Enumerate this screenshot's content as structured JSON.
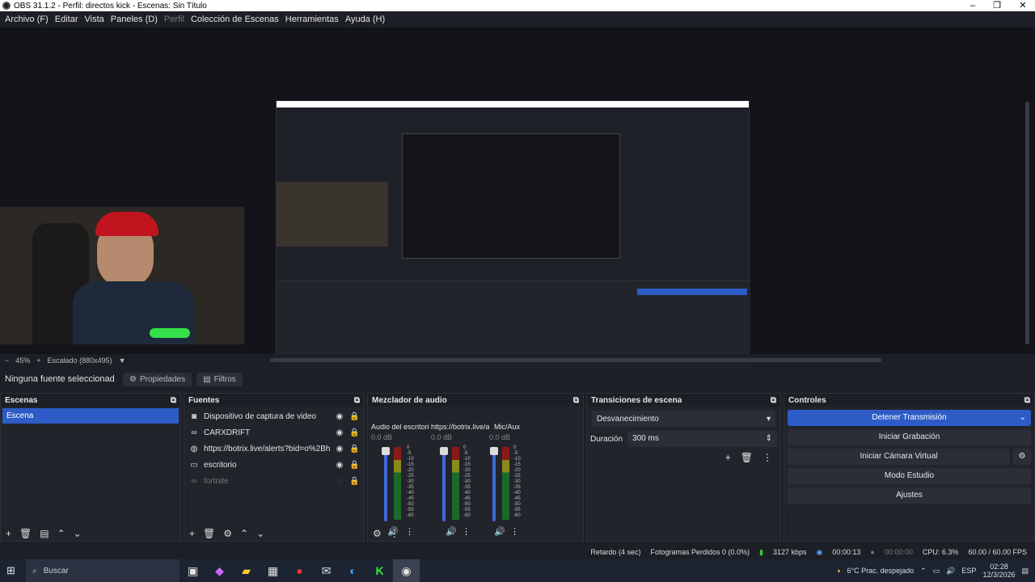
{
  "window": {
    "title": "OBS 31.1.2 - Perfil: directos kick - Escenas: Sin Título"
  },
  "menu": [
    "Archivo (F)",
    "Editar",
    "Vista",
    "Paneles (D)",
    "Perfil",
    "Colección de Escenas",
    "Herramientas",
    "Ayuda (H)"
  ],
  "zoom": {
    "minus": "−",
    "value": "45%",
    "plus": "+",
    "scaling": "Escalado (880x495)"
  },
  "source_bar": {
    "none_selected": "Ninguna fuente seleccionad",
    "properties": "Propiedades",
    "filters": "Filtros"
  },
  "scenes": {
    "title": "Escenas",
    "items": [
      "Escena"
    ]
  },
  "sources": {
    "title": "Fuentes",
    "items": [
      {
        "name": "Dispositivo de captura de video",
        "icon": "camera-icon"
      },
      {
        "name": "CARXDRIFT",
        "icon": "link-icon"
      },
      {
        "name": "https://botrix.live/alerts?bid=o%2Bh3Wzj",
        "icon": "globe-icon"
      },
      {
        "name": "escritorio",
        "icon": "monitor-icon"
      },
      {
        "name": "fortnite",
        "icon": "link-icon"
      }
    ]
  },
  "mixer": {
    "title": "Mezclador de audio",
    "channels": [
      {
        "name": "Audio del escritorio",
        "db": "0.0 dB"
      },
      {
        "name": "https://botrix.live/a",
        "db": "0.0 dB"
      },
      {
        "name": "Mic/Aux",
        "db": "0.0 dB"
      }
    ],
    "scale": [
      "0",
      "-5",
      "-10",
      "-15",
      "-20",
      "-25",
      "-30",
      "-35",
      "-40",
      "-45",
      "-50",
      "-55",
      "-60"
    ]
  },
  "transitions": {
    "title": "Transiciones de escena",
    "selected": "Desvanecimiento",
    "duration_label": "Duración",
    "duration_value": "300 ms"
  },
  "controls": {
    "title": "Controles",
    "stop_stream": "Detener Transmisión",
    "start_recording": "Iniciar Grabación",
    "virtual_cam": "Iniciar Cámara Virtual",
    "studio_mode": "Modo Estudio",
    "settings": "Ajustes"
  },
  "status": {
    "delay": "Retardo (4 sec)",
    "dropped": "Fotogramas Perdidos 0 (0.0%)",
    "bitrate": "3127 kbps",
    "stream_time": "00:00:13",
    "rec_time": "00:00:00",
    "cpu": "CPU: 6.3%",
    "fps": "60.00 / 60.00 FPS"
  },
  "taskbar": {
    "search": "Buscar",
    "weather": "6°C  Prac. despejado",
    "lang": "ESP",
    "time": "02:28",
    "date": "12/3/2026"
  }
}
